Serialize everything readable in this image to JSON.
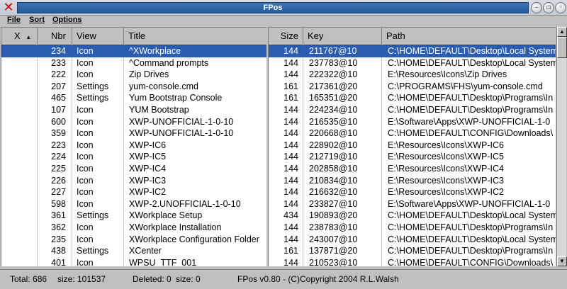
{
  "window": {
    "title": "FPos"
  },
  "menu": {
    "file": "File",
    "sort": "Sort",
    "options": "Options"
  },
  "left": {
    "headers": {
      "x": "X",
      "sort_arrow": "▲",
      "nbr": "Nbr",
      "view": "View",
      "title": "Title"
    },
    "rows": [
      {
        "nbr": "234",
        "view": "Icon",
        "title": "^XWorkplace"
      },
      {
        "nbr": "233",
        "view": "Icon",
        "title": "^Command prompts"
      },
      {
        "nbr": "222",
        "view": "Icon",
        "title": "Zip Drives"
      },
      {
        "nbr": "207",
        "view": "Settings",
        "title": "yum-console.cmd"
      },
      {
        "nbr": "465",
        "view": "Settings",
        "title": "Yum Bootstrap Console"
      },
      {
        "nbr": "107",
        "view": "Icon",
        "title": "YUM Bootstrap"
      },
      {
        "nbr": "600",
        "view": "Icon",
        "title": "XWP-UNOFFICIAL-1-0-10"
      },
      {
        "nbr": "359",
        "view": "Icon",
        "title": "XWP-UNOFFICIAL-1-0-10"
      },
      {
        "nbr": "223",
        "view": "Icon",
        "title": "XWP-IC6"
      },
      {
        "nbr": "224",
        "view": "Icon",
        "title": "XWP-IC5"
      },
      {
        "nbr": "225",
        "view": "Icon",
        "title": "XWP-IC4"
      },
      {
        "nbr": "226",
        "view": "Icon",
        "title": "XWP-IC3"
      },
      {
        "nbr": "227",
        "view": "Icon",
        "title": "XWP-IC2"
      },
      {
        "nbr": "598",
        "view": "Icon",
        "title": "XWP-2.UNOFFICIAL-1-0-10"
      },
      {
        "nbr": "361",
        "view": "Settings",
        "title": "XWorkplace Setup"
      },
      {
        "nbr": "362",
        "view": "Icon",
        "title": "XWorkplace Installation"
      },
      {
        "nbr": "235",
        "view": "Icon",
        "title": "XWorkplace Configuration Folder"
      },
      {
        "nbr": "438",
        "view": "Settings",
        "title": "XCenter"
      },
      {
        "nbr": "401",
        "view": "Icon",
        "title": "WPSU_TTF_001"
      }
    ]
  },
  "right": {
    "headers": {
      "size": "Size",
      "key": "Key",
      "path": "Path"
    },
    "rows": [
      {
        "size": "144",
        "key": "211767@10",
        "path": "C:\\HOME\\DEFAULT\\Desktop\\Local System"
      },
      {
        "size": "144",
        "key": "237783@10",
        "path": "C:\\HOME\\DEFAULT\\Desktop\\Local System"
      },
      {
        "size": "144",
        "key": "222322@10",
        "path": "E:\\Resources\\Icons\\Zip Drives"
      },
      {
        "size": "161",
        "key": "217361@20",
        "path": "C:\\PROGRAMS\\FHS\\yum-console.cmd"
      },
      {
        "size": "161",
        "key": "165351@20",
        "path": "C:\\HOME\\DEFAULT\\Desktop\\Programs\\In"
      },
      {
        "size": "144",
        "key": "224234@10",
        "path": "C:\\HOME\\DEFAULT\\Desktop\\Programs\\In"
      },
      {
        "size": "144",
        "key": "216535@10",
        "path": "E:\\Software\\Apps\\XWP-UNOFFICIAL-1-0"
      },
      {
        "size": "144",
        "key": "220668@10",
        "path": "C:\\HOME\\DEFAULT\\CONFIG\\Downloads\\"
      },
      {
        "size": "144",
        "key": "228902@10",
        "path": "E:\\Resources\\Icons\\XWP-IC6"
      },
      {
        "size": "144",
        "key": "212719@10",
        "path": "E:\\Resources\\Icons\\XWP-IC5"
      },
      {
        "size": "144",
        "key": "202858@10",
        "path": "E:\\Resources\\Icons\\XWP-IC4"
      },
      {
        "size": "144",
        "key": "210834@10",
        "path": "E:\\Resources\\Icons\\XWP-IC3"
      },
      {
        "size": "144",
        "key": "216632@10",
        "path": "E:\\Resources\\Icons\\XWP-IC2"
      },
      {
        "size": "144",
        "key": "233827@10",
        "path": "E:\\Software\\Apps\\XWP-UNOFFICIAL-1-0"
      },
      {
        "size": "434",
        "key": "190893@20",
        "path": "C:\\HOME\\DEFAULT\\Desktop\\Local System"
      },
      {
        "size": "144",
        "key": "238783@10",
        "path": "C:\\HOME\\DEFAULT\\Desktop\\Programs\\In"
      },
      {
        "size": "144",
        "key": "243007@10",
        "path": "C:\\HOME\\DEFAULT\\Desktop\\Local System"
      },
      {
        "size": "161",
        "key": "137871@20",
        "path": "C:\\HOME\\DEFAULT\\Desktop\\Programs\\In"
      },
      {
        "size": "144",
        "key": "210523@10",
        "path": "C:\\HOME\\DEFAULT\\CONFIG\\Downloads\\"
      }
    ]
  },
  "selected_row": 0,
  "status": {
    "total": "Total: 686",
    "size": "size: 101537",
    "deleted": "Deleted: 0",
    "deleted_size": "size: 0",
    "copyright": "FPos v0.80 - (C)Copyright 2004  R.L.Walsh"
  },
  "colors": {
    "selection": "#2a5db0",
    "title_bar": "#265a9c",
    "close": "#d40000"
  },
  "icons": [
    "close-icon",
    "minimize-icon",
    "restore-icon",
    "maximize-icon",
    "sort-ascending-icon",
    "scroll-up-icon",
    "scroll-down-icon"
  ]
}
